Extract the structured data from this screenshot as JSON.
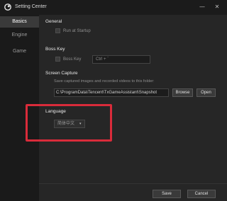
{
  "window": {
    "title": "Setting Center",
    "minimize_glyph": "—",
    "close_glyph": "✕"
  },
  "sidebar": {
    "items": [
      {
        "label": "Basics",
        "active": true
      },
      {
        "label": "Engine",
        "active": false
      },
      {
        "label": "Game",
        "active": false
      }
    ]
  },
  "general": {
    "title": "General",
    "run_at_startup_label": "Run at Startup",
    "run_at_startup_checked": false
  },
  "boss_key": {
    "title": "Boss Key",
    "checkbox_label": "Boss Key",
    "checked": false,
    "shortcut_value": "Ctrl + `"
  },
  "screen_capture": {
    "title": "Screen Capture",
    "description": "Save captured images and recorded videos to this folder:",
    "folder_path": "C:\\ProgramData\\Tencent\\TxGameAssistant\\Snapshot",
    "browse_label": "Browse",
    "open_label": "Open"
  },
  "language": {
    "title": "Language",
    "selected": "简体中文",
    "caret": "▾"
  },
  "footer": {
    "save_label": "Save",
    "cancel_label": "Cancel"
  },
  "colors": {
    "highlight": "#d92b3a",
    "sidebar_active": "#3a3a3a",
    "background": "#262626"
  }
}
